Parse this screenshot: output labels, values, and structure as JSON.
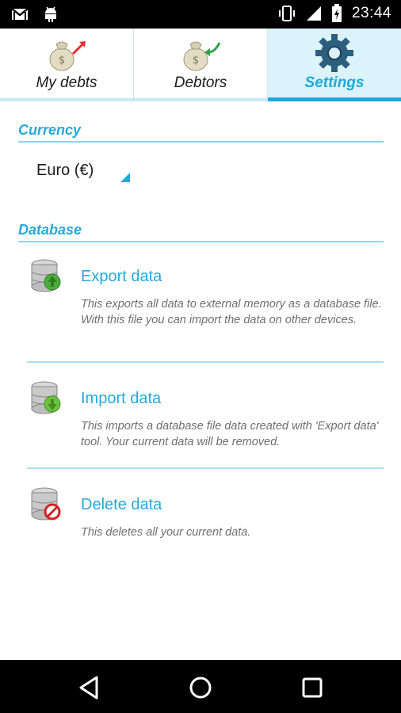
{
  "status_bar": {
    "time": "23:44",
    "icons_left": [
      "gmail-icon",
      "android-debug-icon"
    ],
    "icons_right": [
      "vibrate-icon",
      "signal-icon",
      "battery-icon"
    ]
  },
  "tabs": [
    {
      "label": "My debts",
      "icon": "money-bag-out-icon",
      "selected": false
    },
    {
      "label": "Debtors",
      "icon": "money-bag-in-icon",
      "selected": false
    },
    {
      "label": "Settings",
      "icon": "gear-icon",
      "selected": true
    }
  ],
  "currency": {
    "header": "Currency",
    "selected": "Euro (€)"
  },
  "database": {
    "header": "Database",
    "items": [
      {
        "title": "Export data",
        "description": "This exports all data to external memory as a database file. With this file you can import the data on other devices.",
        "icon": "database-export-icon"
      },
      {
        "title": "Import data",
        "description": "This imports a database file data created with 'Export data' tool. Your current data will be removed.",
        "icon": "database-import-icon"
      },
      {
        "title": "Delete data",
        "description": "This deletes all your current data.",
        "icon": "database-delete-icon"
      }
    ]
  },
  "nav_bar": [
    "back-icon",
    "home-icon",
    "recents-icon"
  ],
  "colors": {
    "accent": "#25a9dc",
    "selected_tab_bg": "#dcf3fb",
    "status_bar": "#000000",
    "description_text": "#6f6f6f"
  }
}
